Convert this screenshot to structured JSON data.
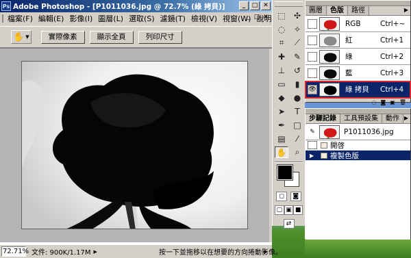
{
  "window": {
    "title": "Adobe Photoshop - [P1011036.jpg @ 72.7% (綠 拷貝)]",
    "icon": "photoshop-icon",
    "caption_buttons": [
      "_",
      "□",
      "✕"
    ]
  },
  "menubar": {
    "items": [
      "檔案(F)",
      "編輯(E)",
      "影像(I)",
      "圖層(L)",
      "選取(S)",
      "濾鏡(T)",
      "檢視(V)",
      "視窗(W)",
      "說明(H)"
    ],
    "doc_controls": [
      "_",
      "□",
      "✕"
    ]
  },
  "options_bar": {
    "tool_icon": "hand-icon",
    "buttons": [
      "實際像素",
      "顯示全頁",
      "列印尺寸"
    ]
  },
  "status_bar": {
    "zoom": "72.71%",
    "doc_info": "文件: 900K/1.17M",
    "hint": "按一下並拖移以在想要的方向捲動影像。"
  },
  "toolbox": {
    "tools": [
      "marquee-icon",
      "move-icon",
      "lasso-icon",
      "magic-wand-icon",
      "crop-icon",
      "slice-icon",
      "healing-brush-icon",
      "brush-icon",
      "clone-stamp-icon",
      "history-brush-icon",
      "eraser-icon",
      "gradient-icon",
      "blur-icon",
      "dodge-icon",
      "path-selection-icon",
      "type-icon",
      "pen-icon",
      "shape-icon",
      "notes-icon",
      "eyedropper-icon",
      "hand-icon",
      "zoom-icon"
    ],
    "foreground_color": "#000000",
    "background_color": "#ffffff"
  },
  "channels_panel": {
    "tabs": [
      "圖層",
      "色版",
      "路徑"
    ],
    "active_tab": "色版",
    "channels": [
      {
        "name": "RGB",
        "shortcut": "Ctrl+~",
        "visible": false,
        "selected": false
      },
      {
        "name": "紅",
        "shortcut": "Ctrl+1",
        "visible": false,
        "selected": false
      },
      {
        "name": "綠",
        "shortcut": "Ctrl+2",
        "visible": false,
        "selected": false
      },
      {
        "name": "藍",
        "shortcut": "Ctrl+3",
        "visible": false,
        "selected": false
      },
      {
        "name": "綠 拷貝",
        "shortcut": "Ctrl+4",
        "visible": true,
        "selected": true
      }
    ],
    "highlight_color": "#e0262a"
  },
  "history_panel": {
    "tabs": [
      "步驟記錄",
      "工具預設集",
      "動作"
    ],
    "active_tab": "步驟記錄",
    "snapshot": "P1011036.jpg",
    "steps": [
      {
        "label": "開啓",
        "selected": false
      },
      {
        "label": "複製色版",
        "selected": true
      }
    ]
  },
  "colors": {
    "title_active": "#0a246a",
    "selection": "#0a246a",
    "chrome": "#d4d0c8"
  }
}
